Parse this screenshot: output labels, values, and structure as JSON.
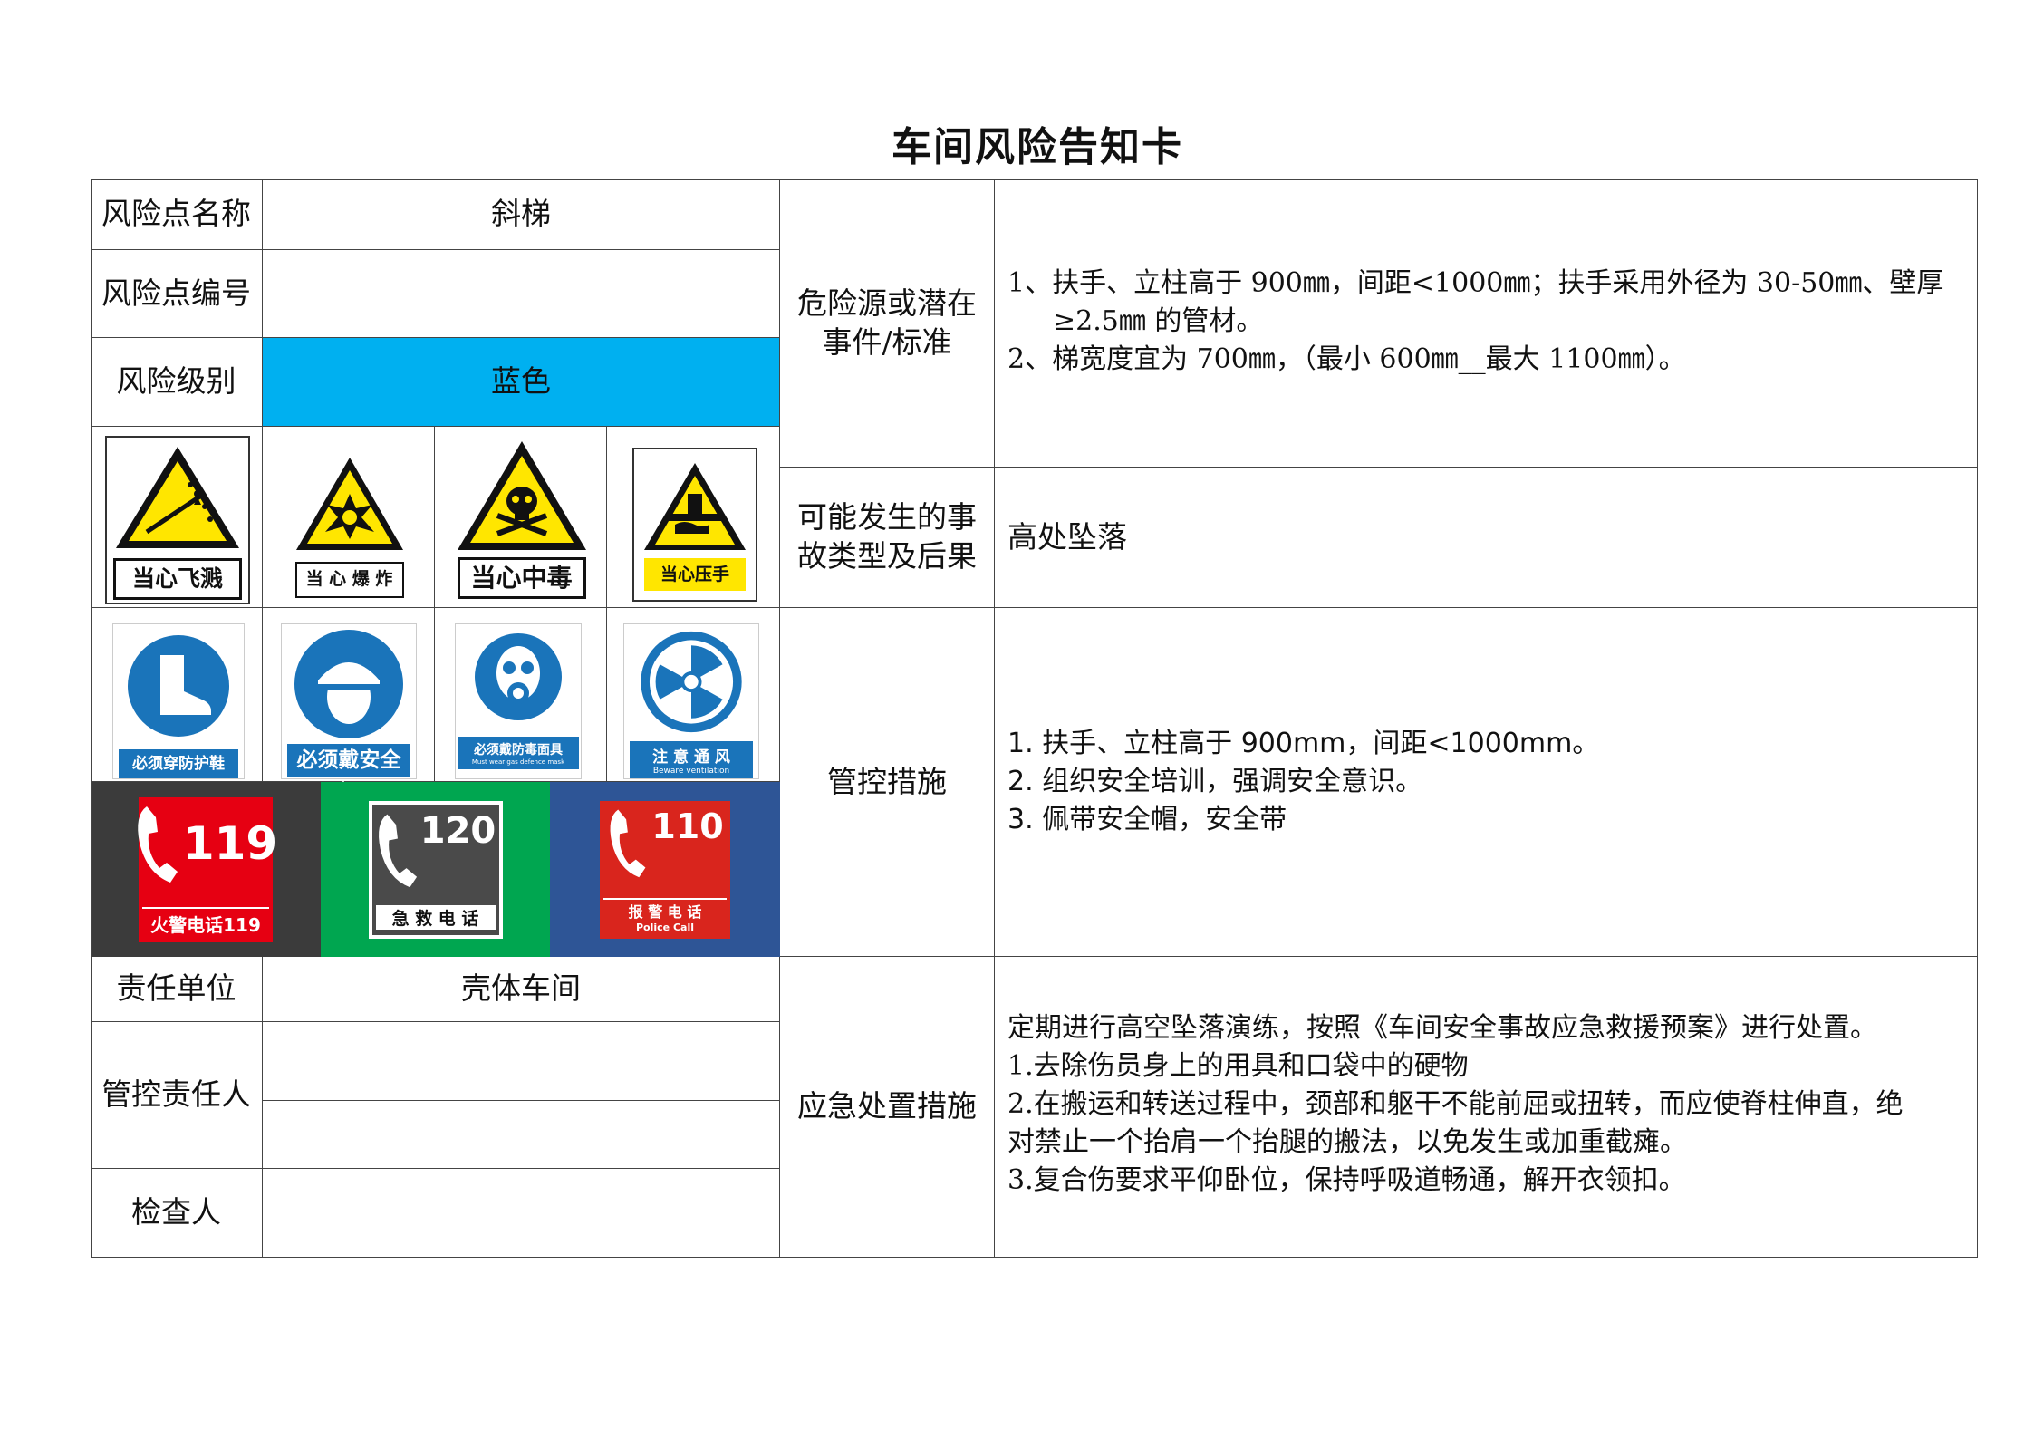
{
  "title": "车间风险告知卡",
  "rows": {
    "name_label": "风险点名称",
    "name_value": "斜梯",
    "code_label": "风险点编号",
    "code_value": "",
    "level_label": "风险级别",
    "level_value": "蓝色",
    "level_color": "#00b0f0",
    "unit_label": "责任单位",
    "unit_value": "壳体车间",
    "person_label": "管控责任人",
    "person_value_1": "",
    "person_value_2": "",
    "inspector_label": "检查人",
    "inspector_value": ""
  },
  "hazard": {
    "label": "危险源或潜在事件/标准",
    "line1": "1、扶手、立柱高于 900㎜，间距<1000㎜；扶手采用外径为 30-50㎜、壁厚",
    "line1b": "≥2.5㎜ 的管材。",
    "line2": "2、梯宽度宜为 700㎜，（最小 600㎜__最大 1100㎜）。"
  },
  "accident": {
    "label": "可能发生的事故类型及后果",
    "value": "高处坠落"
  },
  "control": {
    "label": "管控措施",
    "items": [
      "1.  扶手、立柱高于 900mm，间距<1000mm。",
      "2.  组织安全培训，强调安全意识。",
      "3.  佩带安全帽，安全带"
    ]
  },
  "emergency": {
    "label": "应急处置措施",
    "lines": [
      "定期进行高空坠落演练，按照《车间安全事故应急救援预案》进行处置。",
      "1.去除伤员身上的用具和口袋中的硬物",
      "2.在搬运和转送过程中，颈部和躯干不能前屈或扭转，而应使脊柱伸直，绝",
      "对禁止一个抬肩一个抬腿的搬法，以免发生或加重截瘫。",
      "3.复合伤要求平仰卧位，保持呼吸道畅通，解开衣领扣。"
    ]
  },
  "warning_signs": [
    {
      "icon": "flying-debris-icon",
      "label": "当心飞溅"
    },
    {
      "icon": "explosion-icon",
      "label": "当 心 爆 炸"
    },
    {
      "icon": "poison-skull-icon",
      "label": "当心中毒"
    },
    {
      "icon": "hand-crush-icon",
      "label": "当心压手"
    }
  ],
  "mandatory_signs": [
    {
      "icon": "safety-boot-icon",
      "label": "必须穿防护鞋"
    },
    {
      "icon": "safety-helmet-icon",
      "label": "必须戴安全帽"
    },
    {
      "icon": "gas-mask-icon",
      "label": "必须戴防毒面具",
      "sub": "Must wear gas defence mask"
    },
    {
      "icon": "ventilation-fan-icon",
      "label": "注 意 通 风",
      "sub": "Beware ventilation"
    }
  ],
  "phones": [
    {
      "number": "119",
      "label": "火警电话119",
      "color": "#e60012",
      "band": "#3b3b3b"
    },
    {
      "number": "120",
      "label": "急 救 电 话",
      "color": "#4a4a4a",
      "band": "#00a650"
    },
    {
      "number": "110",
      "label": "报 警 电 话",
      "sub": "Police Call",
      "color": "#d9251d",
      "band": "#2e5596"
    }
  ]
}
